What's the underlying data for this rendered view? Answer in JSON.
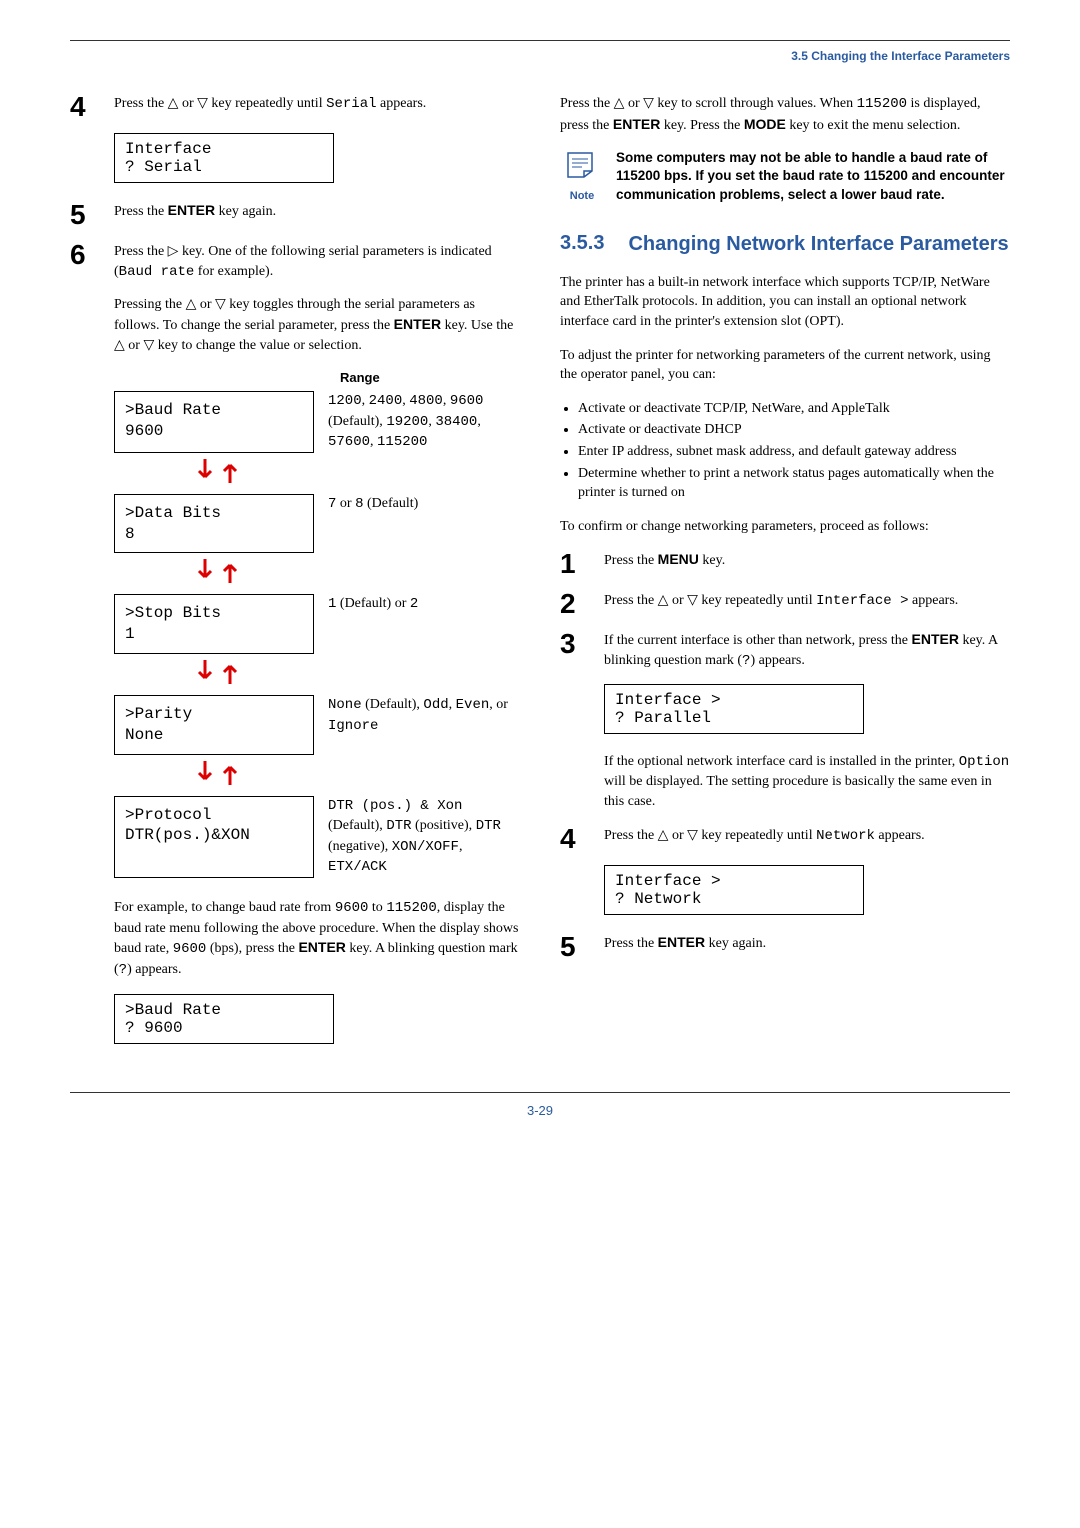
{
  "header": {
    "title": "3.5 Changing the Interface Parameters"
  },
  "left": {
    "step4": {
      "text_a": "Press the ",
      "text_b": " or ",
      "text_c": " key repeatedly until ",
      "mono": "Serial",
      "text_d": " appears.",
      "display_l1": " Interface",
      "display_l2": "? Serial"
    },
    "step5": {
      "text_a": "Press the ",
      "bold": "ENTER",
      "text_b": " key again."
    },
    "step6": {
      "text_a": "Press the ",
      "text_b": " key. One of the following serial parameters is indicated (",
      "mono": "Baud rate",
      "text_c": " for example).",
      "para2_a": "Pressing the ",
      "para2_b": " or ",
      "para2_c": " key toggles through the serial parameters as follows. To change the serial parameter, press the ",
      "para2_bold": "ENTER",
      "para2_d": " key. Use the ",
      "para2_e": " or ",
      "para2_f": " key to change the value or selection."
    },
    "range_heading": "Range",
    "params": {
      "baud": {
        "l1": ">Baud Rate",
        "l2": "   9600",
        "range_a": "1200",
        "range_b": "2400",
        "range_c": "4800",
        "range_d": "9600",
        "range_d_note": " (Default), ",
        "range_e": "19200",
        "range_f": "38400",
        "range_g": "57600",
        "range_h": "115200"
      },
      "databits": {
        "l1": ">Data Bits",
        "l2": " 8",
        "range_a": "7",
        "range_mid": " or ",
        "range_b": "8",
        "range_note": " (Default)"
      },
      "stopbits": {
        "l1": ">Stop Bits",
        "l2": " 1",
        "range_a": "1",
        "range_note": " (Default) or ",
        "range_b": "2"
      },
      "parity": {
        "l1": ">Parity",
        "l2": "  None",
        "range_a": "None",
        "range_a_note": " (Default), ",
        "range_b": "Odd",
        "range_c": "Even",
        "range_mid": ", or ",
        "range_d": "Ignore"
      },
      "protocol": {
        "l1": ">Protocol",
        "l2": " DTR(pos.)&XON",
        "range_a": "DTR (pos.) & Xon",
        "range_a_note": " (Default), ",
        "range_b": "DTR",
        "range_b_note": " (positive), ",
        "range_c": "DTR",
        "range_c_note": " (negative), ",
        "range_d": "XON/XOFF",
        "range_e": "ETX/ACK"
      }
    },
    "bottom_para": {
      "a": "For example, to change baud rate from ",
      "m1": "9600",
      "b": " to ",
      "m2": "115200",
      "c": ", display the baud rate menu following the above procedure. When the display shows baud rate, ",
      "m3": "9600",
      "d": " (bps), press the ",
      "bold": "ENTER",
      "e": " key. A blinking question mark (",
      "m4": "?",
      "f": ") appears."
    },
    "bottom_display": {
      "l1": ">Baud Rate",
      "l2": "?   9600"
    }
  },
  "right": {
    "top_para": {
      "a": "Press the ",
      "b": " or ",
      "c": " key to scroll through values. When ",
      "m1": "115200",
      "d": " is displayed, press the ",
      "bold1": "ENTER",
      "e": " key. Press the ",
      "bold2": "MODE",
      "f": " key to exit the menu selection."
    },
    "note": {
      "label": "Note",
      "text": "Some computers may not be able to handle a baud rate of 115200 bps. If you set the baud rate to 115200 and encounter communication problems, select a lower baud rate."
    },
    "section": {
      "num": "3.5.3",
      "title": "Changing Network Interface Parameters"
    },
    "para1": "The printer has a built-in network interface which supports TCP/IP, NetWare and EtherTalk protocols. In addition, you can install an optional network interface card in the printer's extension slot (OPT).",
    "para2": "To adjust the printer for networking parameters of the current network, using the operator panel, you can:",
    "bullets": {
      "b1": "Activate or deactivate TCP/IP, NetWare, and AppleTalk",
      "b2": "Activate or deactivate DHCP",
      "b3": "Enter IP address, subnet mask address, and default gateway address",
      "b4": "Determine whether to print a network status pages automatically when the printer is turned on"
    },
    "para3": "To confirm or change networking parameters, proceed as follows:",
    "step1": {
      "a": "Press the ",
      "bold": "MENU",
      "b": " key."
    },
    "step2": {
      "a": "Press the ",
      "b": " or ",
      "c": " key repeatedly until ",
      "mono": "Interface >",
      "d": " appears."
    },
    "step3": {
      "a": "If the current interface is other than network, press the ",
      "bold": "ENTER",
      "b": " key. A blinking question mark (",
      "m": "?",
      "c": ") appears.",
      "display_l1": " Interface       >",
      "display_l2": "? Parallel",
      "para2_a": "If the optional network interface card is installed in the printer, ",
      "para2_m": "Option",
      "para2_b": " will be displayed. The setting procedure is basically the same even in this case."
    },
    "step4": {
      "a": "Press the ",
      "b": " or ",
      "c": " key repeatedly until ",
      "m": "Network",
      "d": " appears.",
      "display_l1": " Interface       >",
      "display_l2": "? Network"
    },
    "step5": {
      "a": "Press the ",
      "bold": "ENTER",
      "b": " key again."
    }
  },
  "footer": {
    "page": "3-29"
  },
  "glyphs": {
    "up": "△",
    "down": "▽",
    "right": "▷"
  }
}
